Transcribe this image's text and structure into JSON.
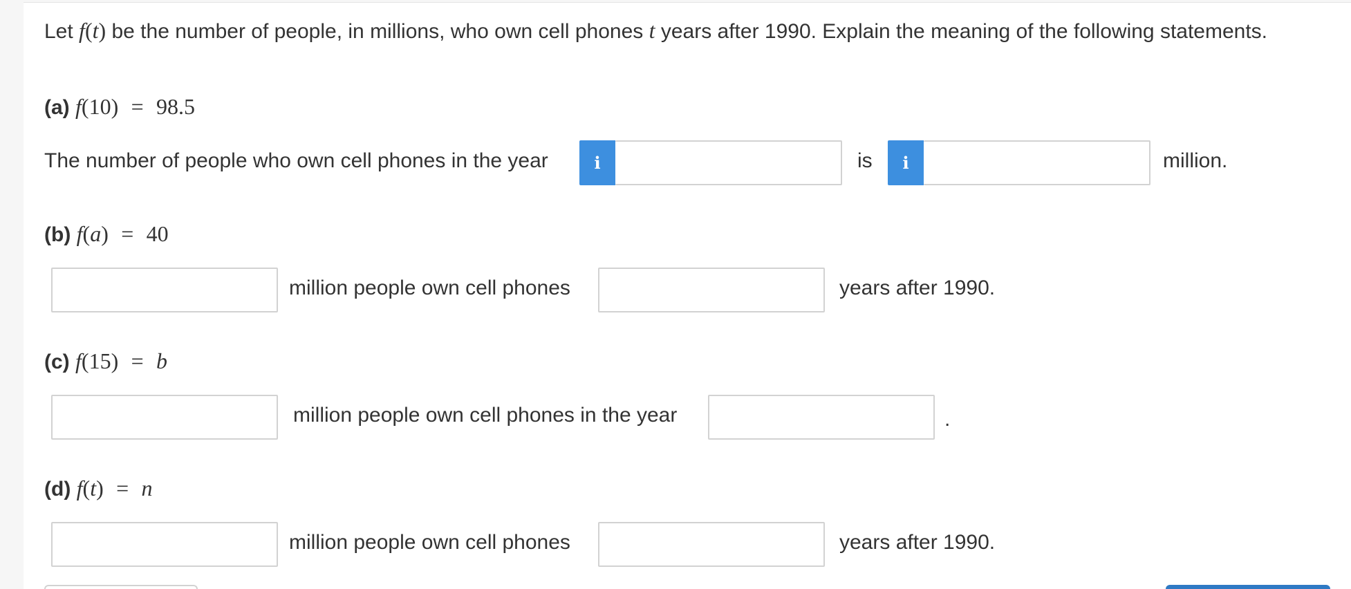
{
  "prompt": {
    "before": "Let ",
    "fn": "f",
    "arg": "t",
    "middle": " be the number of people, in millions, who own cell phones ",
    "var": "t",
    "after": " years after 1990. Explain the meaning of the following statements."
  },
  "part_a": {
    "label": "(a)",
    "equation": {
      "lhs_fn": "f",
      "lhs_arg": "(10)",
      "eq": "=",
      "rhs": "98.5"
    },
    "sentence_start": "The number of people who own cell phones in the year",
    "info_icon": "i",
    "is_text": "is",
    "end_text": "million."
  },
  "part_b": {
    "label": "(b)",
    "equation": {
      "lhs_fn": "f",
      "lhs_arg": "a",
      "eq": "=",
      "rhs": "40"
    },
    "middle_text": "million people own cell phones",
    "end_text": "years after 1990."
  },
  "part_c": {
    "label": "(c)",
    "equation": {
      "lhs_fn": "f",
      "lhs_arg": "(15)",
      "eq": "=",
      "rhs": "b"
    },
    "middle_text": "million people own cell phones in the year",
    "end_text": "."
  },
  "part_d": {
    "label": "(d)",
    "equation": {
      "lhs_fn": "f",
      "lhs_arg": "t",
      "eq": "=",
      "rhs": "n"
    },
    "middle_text": "million people own cell phones",
    "end_text": "years after 1990."
  },
  "inputs": {
    "a_year": "",
    "a_count": "",
    "b_count": "",
    "b_years": "",
    "c_count": "",
    "c_year": "",
    "d_count": "",
    "d_years": ""
  },
  "colors": {
    "info_blue": "#3d8fdf",
    "button_blue": "#2f7ac4"
  }
}
